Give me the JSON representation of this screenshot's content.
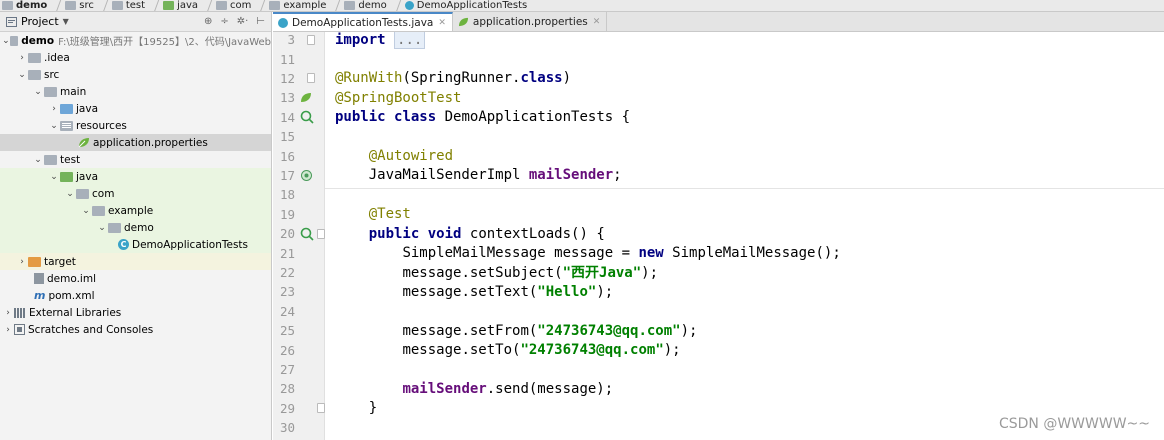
{
  "breadcrumb": [
    "demo",
    "src",
    "test",
    "java",
    "com",
    "example",
    "demo",
    "DemoApplicationTests"
  ],
  "project_panel": {
    "title": "Project",
    "rows": [
      {
        "label": "demo",
        "path": "F:\\班级管理\\西开【19525】\\2、代码\\JavaWeb"
      },
      {
        "label": ".idea"
      },
      {
        "label": "src"
      },
      {
        "label": "main"
      },
      {
        "label": "java"
      },
      {
        "label": "resources"
      },
      {
        "label": "application.properties"
      },
      {
        "label": "test"
      },
      {
        "label": "java"
      },
      {
        "label": "com"
      },
      {
        "label": "example"
      },
      {
        "label": "demo"
      },
      {
        "label": "DemoApplicationTests"
      },
      {
        "label": "target"
      },
      {
        "label": "demo.iml"
      },
      {
        "label": "pom.xml"
      },
      {
        "label": "External Libraries"
      },
      {
        "label": "Scratches and Consoles"
      }
    ]
  },
  "tabs": [
    {
      "label": "DemoApplicationTests.java",
      "active": true
    },
    {
      "label": "application.properties",
      "active": false
    }
  ],
  "editor": {
    "line_numbers": [
      "3",
      "11",
      "12",
      "13",
      "14",
      "15",
      "16",
      "17",
      "18",
      "19",
      "20",
      "21",
      "22",
      "23",
      "24",
      "25",
      "26",
      "27",
      "28",
      "29",
      "30"
    ],
    "code": {
      "l3_kw": "import",
      "l3_fold": "...",
      "l12_ann": "@RunWith",
      "l12_a": "(SpringRunner.",
      "l12_b": "class",
      "l12_c": ")",
      "l13_ann": "@SpringBootTest",
      "l14_kw1": "public",
      "l14_kw2": "class",
      "l14_name": "DemoApplicationTests {",
      "l16_ann": "@Autowired",
      "l17_type": "JavaMailSenderImpl ",
      "l17_fld": "mailSender",
      "l17_end": ";",
      "l19_ann": "@Test",
      "l20_kw1": "public",
      "l20_kw2": "void",
      "l20_rest": "contextLoads() {",
      "l21_a": "SimpleMailMessage message = ",
      "l21_kw": "new",
      "l21_b": " SimpleMailMessage();",
      "l22_a": "message.setSubject(",
      "l22_str": "\"西开Java\"",
      "l22_b": ");",
      "l23_a": "message.setText(",
      "l23_str": "\"Hello\"",
      "l23_b": ");",
      "l25_a": "message.setFrom(",
      "l25_str": "\"24736743@qq.com\"",
      "l25_b": ");",
      "l26_a": "message.setTo(",
      "l26_str": "\"24736743@qq.com\"",
      "l26_b": ");",
      "l28_fld": "mailSender",
      "l28_b": ".send(message);",
      "l29": "}"
    }
  },
  "watermark": "CSDN @WWWWW~~",
  "colors": {
    "keyword": "#000080",
    "annotation": "#808000",
    "string": "#008000",
    "field": "#660e7a",
    "accent": "#4a88c7"
  }
}
